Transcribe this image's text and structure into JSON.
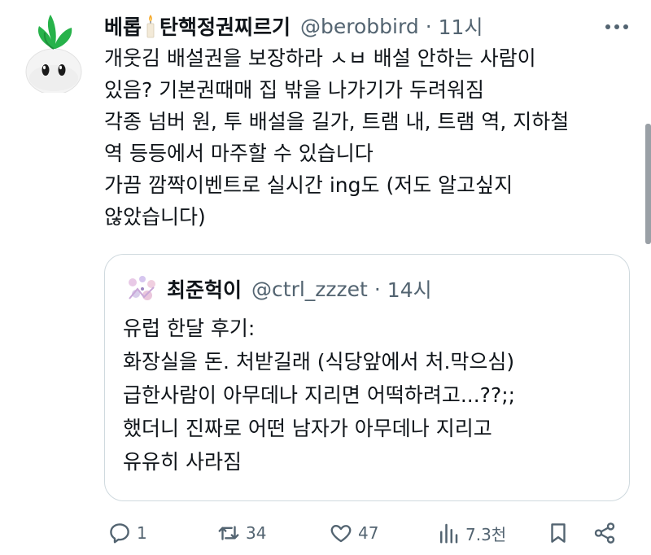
{
  "tweet": {
    "display_name": "베롭",
    "display_name_suffix": "탄핵정권찌르기",
    "handle": "@berobbird",
    "separator": "·",
    "time": "11시",
    "body_lines": [
      "개웃김 배설권을 보장하라 ㅅㅂ 배설 안하는 사람이",
      "있음? 기본권때매 집 밖을 나가기가 두려워짐",
      "각종 넘버 원, 투 배설을 길가, 트램 내, 트램 역, 지하철",
      "역 등등에서 마주할 수 있습니다",
      "가끔 깜짝이벤트로 실시간 ing도 (저도 알고싶지",
      "않았습니다)"
    ]
  },
  "quote": {
    "display_name": "최준헉이",
    "handle": "@ctrl_zzzet",
    "separator": "·",
    "time": "14시",
    "body_lines": [
      "유럽 한달 후기:",
      "화장실을 돈. 처받길래 (식당앞에서 처.막으심)",
      "급한사람이 아무데나 지리면 어떡하려고...??;;",
      "했더니 진짜로 어떤 남자가 아무데나 지리고",
      "유유히 사라짐"
    ]
  },
  "actions": {
    "reply_count": "1",
    "retweet_count": "34",
    "like_count": "47",
    "views_count": "7.3천"
  },
  "icons": {
    "avatar": "turnip-sprout-icon",
    "candle": "candle-icon",
    "more": "more-horizontal-icon",
    "reply": "reply-icon",
    "retweet": "retweet-icon",
    "like": "heart-icon",
    "views": "views-chart-icon",
    "bookmark": "bookmark-icon",
    "share": "share-icon"
  },
  "colors": {
    "text_primary": "#0f1419",
    "text_secondary": "#536471",
    "border": "#cfd9de"
  }
}
